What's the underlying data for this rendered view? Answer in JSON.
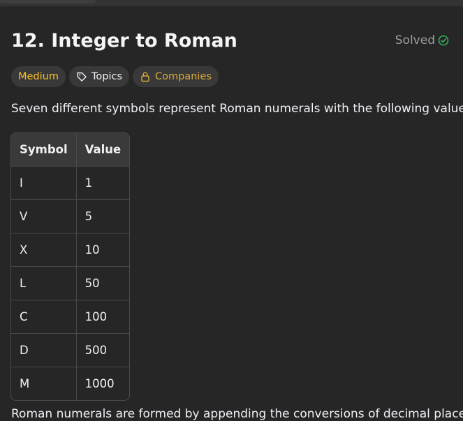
{
  "problem": {
    "title": "12. Integer to Roman",
    "status": "Solved"
  },
  "tags": {
    "difficulty": "Medium",
    "topics": "Topics",
    "companies": "Companies"
  },
  "description": {
    "intro": "Seven different symbols represent Roman numerals with the following values:",
    "partial_next": "Roman numerals are formed by appending the conversions of decimal place"
  },
  "table": {
    "headers": [
      "Symbol",
      "Value"
    ],
    "rows": [
      [
        "I",
        "1"
      ],
      [
        "V",
        "5"
      ],
      [
        "X",
        "10"
      ],
      [
        "L",
        "50"
      ],
      [
        "C",
        "100"
      ],
      [
        "D",
        "500"
      ],
      [
        "M",
        "1000"
      ]
    ]
  },
  "colors": {
    "background": "#262626",
    "medium": "#ffc01e",
    "solved_check": "#2cbb5d",
    "companies": "#d9a93b"
  },
  "icons": {
    "solved": "check-circle-icon",
    "topics": "tag-icon",
    "companies": "lock-icon"
  }
}
